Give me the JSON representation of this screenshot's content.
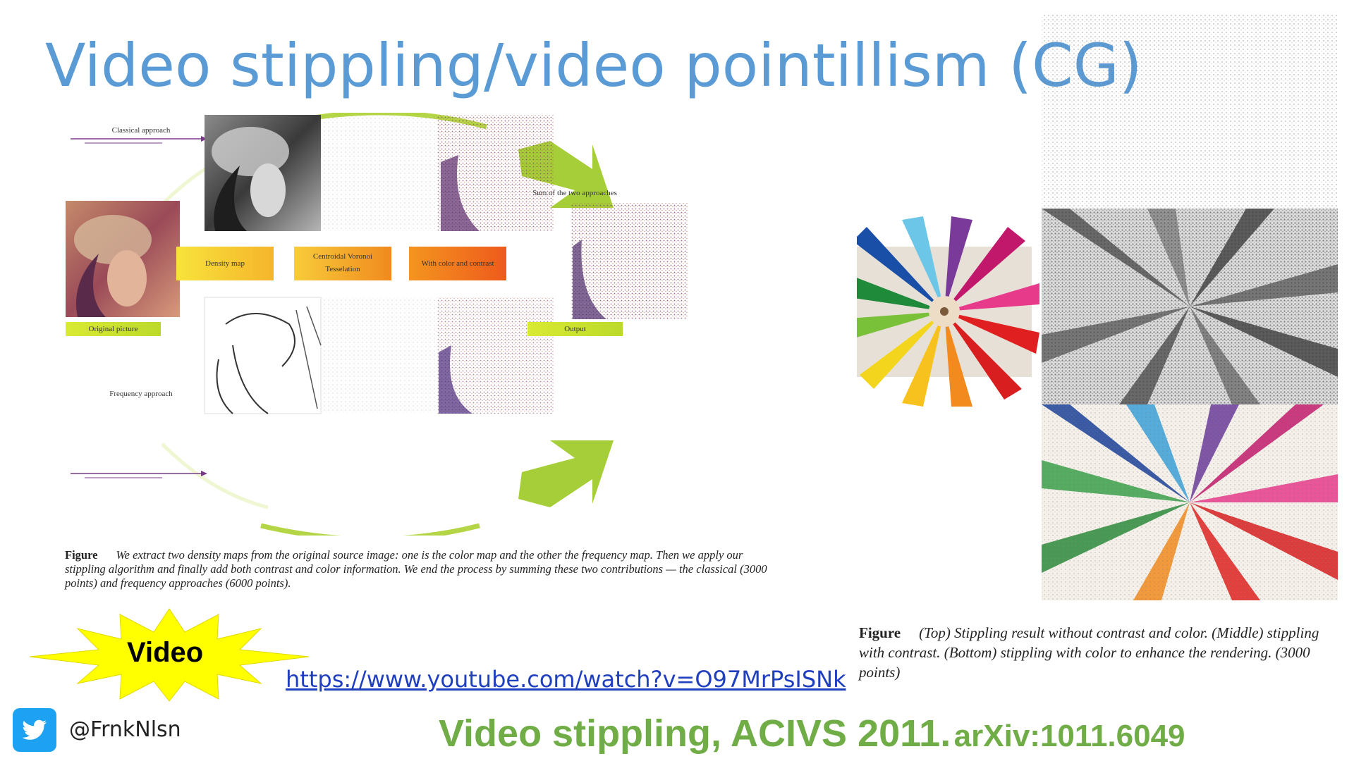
{
  "slide": {
    "title": "Video stippling/video pointillism (CG)",
    "accent_title_color": "#5b9bd5",
    "citation_main": "Video stippling, ACIVS 2011.",
    "citation_arxiv": "arXiv:1011.6049",
    "citation_color": "#70ad47"
  },
  "left_figure": {
    "classical_label": "Classical approach",
    "frequency_label": "Frequency approach",
    "sum_label": "Sum of the two approaches",
    "original_label": "Original picture",
    "output_label": "Output",
    "density_label": "Density map",
    "cvt_label_line1": "Centroidal Voronoi",
    "cvt_label_line2": "Tesselation",
    "color_contrast_label": "With color and contrast",
    "caption_head": "Figure",
    "caption_text": "We extract two density maps from the original source image: one is the color map and the other the frequency map. Then we apply our stippling algorithm and finally add both contrast and color information. We end the process by summing these two contributions — the classical (3000 points) and frequency approaches (6000 points)."
  },
  "right_figure": {
    "caption_head": "Figure",
    "caption_text": "(Top) Stippling result without contrast and color. (Middle) stippling with contrast. (Bottom) stippling with color to enhance the rendering. (3000 points)"
  },
  "video": {
    "badge_text": "Video",
    "badge_color": "#ffff00",
    "url": "https://www.youtube.com/watch?v=O97MrPsISNk"
  },
  "social": {
    "icon": "twitter-bird-icon",
    "handle": "@FrnkNlsn",
    "icon_color": "#1da1f2"
  }
}
